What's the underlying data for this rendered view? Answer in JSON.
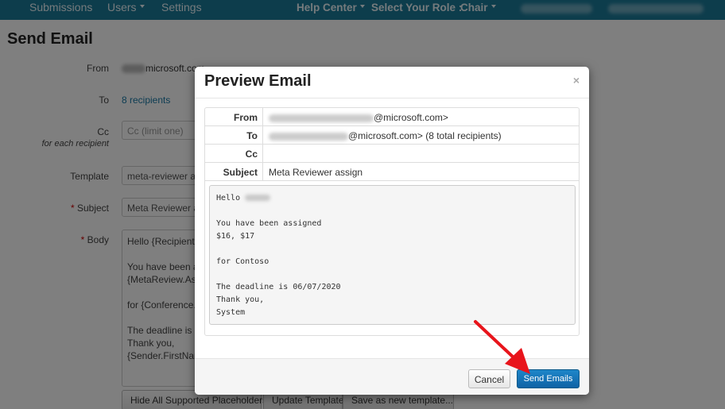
{
  "topnav": {
    "submissions": "Submissions",
    "users": "Users",
    "settings": "Settings",
    "help_center": "Help Center",
    "role_label": "Select Your Role :",
    "role_value": "Chair"
  },
  "page": {
    "title": "Send Email",
    "from_label": "From",
    "from_value": "microsoft.com",
    "to_label": "To",
    "to_value": "8 recipients",
    "cc_label": "Cc",
    "cc_sub": "for each recipient",
    "cc_placeholder": "Cc (limit one)",
    "template_label": "Template",
    "template_value": "meta-reviewer assign",
    "subject_label": "Subject",
    "subject_value": "Meta Reviewer assign",
    "body_label": "Body",
    "body_value": "Hello {Recipient.FirstName}\n\nYou have been assigned\n{MetaReview.Assignments}\n\nfor {Conference.Name}\n\nThe deadline is 06/07/2020\nThank you,\n{Sender.FirstName}",
    "btn_hide_placeholders": "Hide All Supported Placeholders",
    "btn_update_template": "Update Template",
    "btn_save_template": "Save as new template..."
  },
  "modal": {
    "title": "Preview Email",
    "close": "×",
    "from_label": "From",
    "from_value": "@microsoft.com>",
    "to_label": "To",
    "to_value": "@microsoft.com> (8 total recipients)",
    "cc_label": "Cc",
    "cc_value": "",
    "subject_label": "Subject",
    "subject_value": "Meta Reviewer assign",
    "body": {
      "greeting": "Hello",
      "line1": "You have been assigned",
      "line2": "$16, $17",
      "line3": "for Contoso",
      "line4": "The deadline is 06/07/2020",
      "line5": "Thank you,",
      "line6": "System"
    },
    "cancel": "Cancel",
    "send": "Send Emails"
  },
  "colors": {
    "nav_bg": "#1b7a99",
    "primary_button": "#0f63a5",
    "arrow": "#e8141b"
  }
}
